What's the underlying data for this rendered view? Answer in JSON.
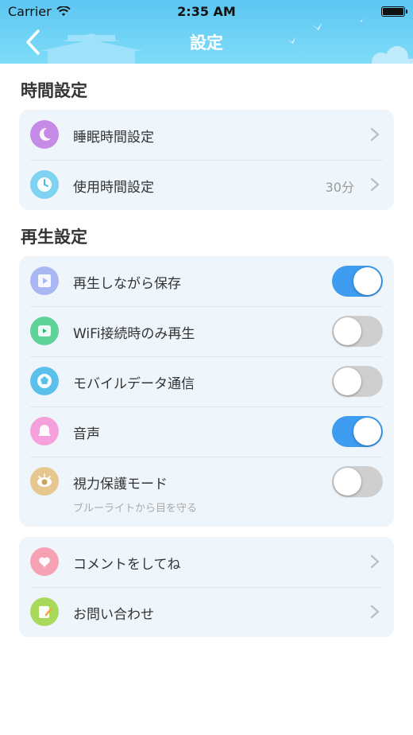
{
  "status_bar": {
    "carrier": "Carrier",
    "time": "2:35 AM",
    "battery_level": 1.0
  },
  "header": {
    "title": "設定"
  },
  "sections": {
    "time": {
      "title": "時間設定",
      "rows": [
        {
          "label": "睡眠時間設定",
          "value": "",
          "icon": "moon-icon",
          "color": "#c58be6"
        },
        {
          "label": "使用時間設定",
          "value": "30分",
          "icon": "clock-icon",
          "color": "#7fd2f0"
        }
      ]
    },
    "playback": {
      "title": "再生設定",
      "rows": [
        {
          "label": "再生しながら保存",
          "on": true,
          "icon": "save-video-icon",
          "color": "#a9b8f2"
        },
        {
          "label": "WiFi接続時のみ再生",
          "on": false,
          "icon": "wifi-play-icon",
          "color": "#5fd39a"
        },
        {
          "label": "モバイルデータ通信",
          "on": false,
          "icon": "mobile-data-icon",
          "color": "#5cc1ea"
        },
        {
          "label": "音声",
          "on": true,
          "icon": "bell-icon",
          "color": "#f5a0dc"
        },
        {
          "label": "視力保護モード",
          "sub": "ブルーライトから目を守る",
          "on": false,
          "icon": "eye-icon",
          "color": "#e7c790"
        }
      ]
    },
    "other": {
      "rows": [
        {
          "label": "コメントをしてね",
          "icon": "heart-icon",
          "color": "#f7a1b5"
        },
        {
          "label": "お問い合わせ",
          "icon": "memo-icon",
          "color": "#a8d95a"
        }
      ]
    }
  },
  "colors": {
    "accent": "#3e9df0",
    "header_top": "#5cc6f2",
    "card_bg": "#eef6fc"
  }
}
